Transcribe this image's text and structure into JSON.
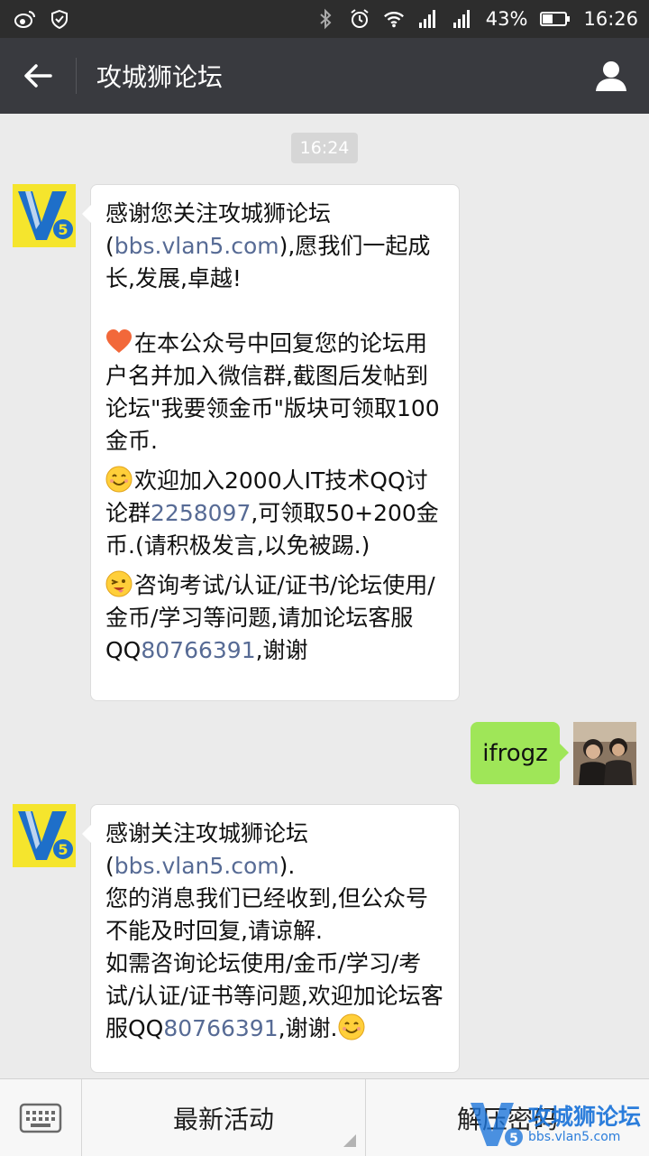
{
  "status_bar": {
    "battery": "43%",
    "time": "16:26",
    "icons": [
      "weibo-icon",
      "location-shield-icon",
      "bluetooth-icon",
      "alarm-icon",
      "wifi-icon",
      "signal-icon",
      "signal-icon",
      "battery-icon"
    ]
  },
  "header": {
    "title": "攻城狮论坛"
  },
  "chat": {
    "time_label": "16:24",
    "msg1": {
      "line1": "感谢您关注攻城狮论坛",
      "link1": "bbs.vlan5.com",
      "line1b": "),愿我们一起成",
      "line1c": "长,发展,卓越!",
      "para2": "在本公众号中回复您的论坛用户名并加入微信群,截图后发帖到论坛\"我要领金币\"版块可领取100金币.",
      "para3_a": "欢迎加入2000人IT技术QQ讨论群",
      "para3_link": "2258097",
      "para3_b": ",可领取50+200金币.(请积极发言,以免被踢.)",
      "para4_a": "咨询考试/认证/证书/论坛使用/金币/学习等问题,请加论坛客服QQ",
      "para4_link": "80766391",
      "para4_b": ",谢谢"
    },
    "msg2": {
      "text": "ifrogz"
    },
    "msg3": {
      "line1": "感谢关注攻城狮论坛",
      "link1": "bbs.vlan5.com",
      "line1b": ").",
      "line2": "您的消息我们已经收到,但公众号不能及时回复,请谅解.",
      "line3": "如需咨询论坛使用/金币/学习/考试/认证/证书等问题,欢迎加论坛客服QQ",
      "link2": "80766391",
      "line3b": ",谢谢."
    },
    "avatar_logo": "V5"
  },
  "bottom_menu": {
    "items": [
      "最新活动",
      "解压密码"
    ]
  },
  "watermark": {
    "title": "攻城狮论坛",
    "sub": "bbs.vlan5.com"
  },
  "colors": {
    "link": "#576b95",
    "green_bubble": "#9fe658",
    "titlebar": "#393a3f"
  }
}
